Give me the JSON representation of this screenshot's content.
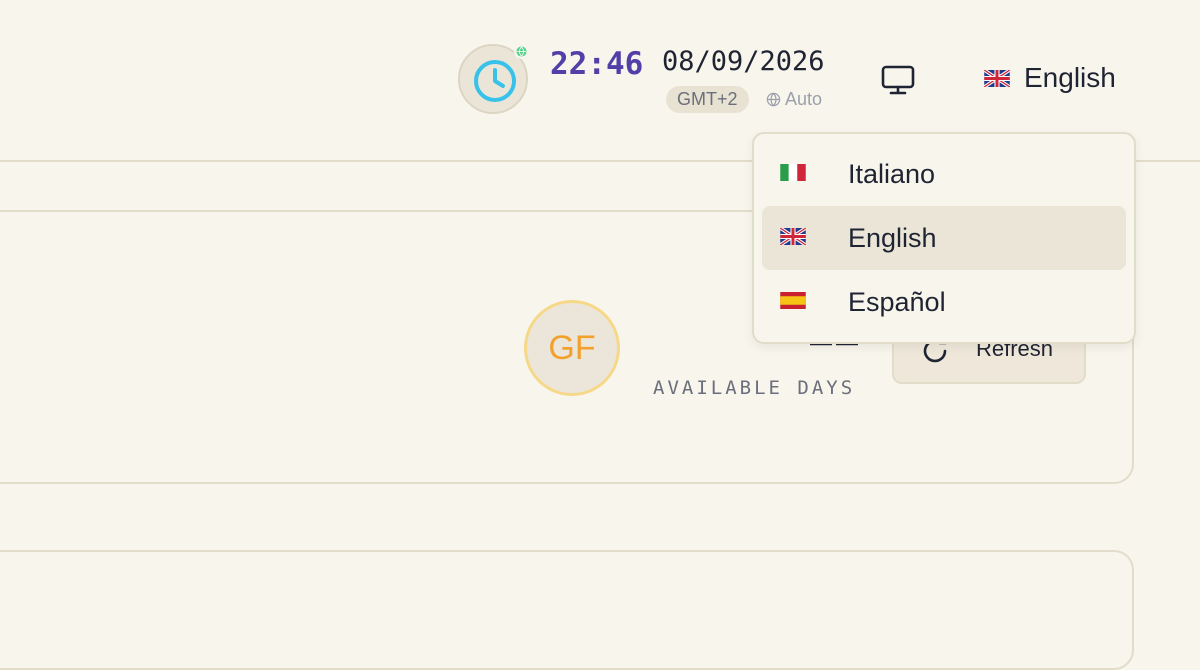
{
  "header": {
    "time": "22:46",
    "date": "08/09/2026",
    "timezone": "GMT+2",
    "timezone_mode": "Auto",
    "current_language": "English",
    "accent_color": "#5040a8"
  },
  "main": {
    "avatar_initials": "GF",
    "available_days_label": "AVAILABLE DAYS",
    "refresh_label": "Refresh"
  },
  "language_menu": {
    "items": [
      {
        "label": "Italiano",
        "flag": "italy-flag-icon",
        "selected": false
      },
      {
        "label": "English",
        "flag": "uk-flag-icon",
        "selected": true
      },
      {
        "label": "Español",
        "flag": "spain-flag-icon",
        "selected": false
      }
    ]
  }
}
